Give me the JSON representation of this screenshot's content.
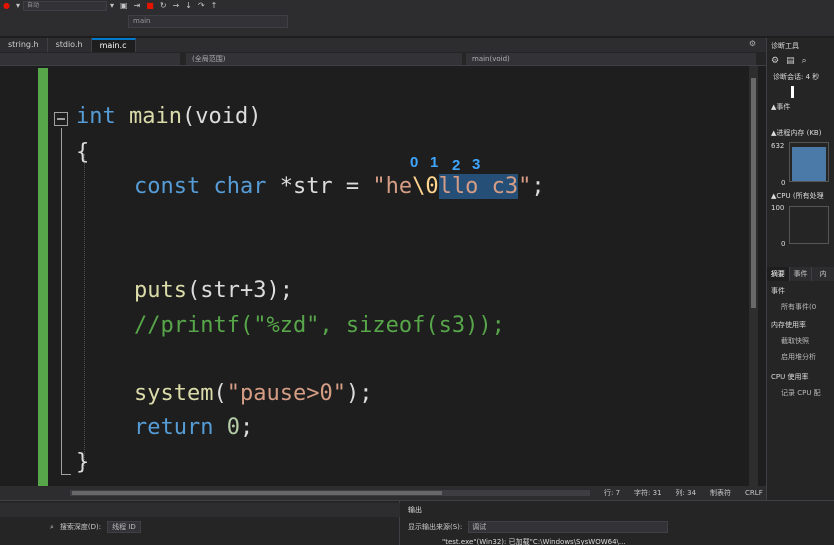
{
  "toolbar": {
    "config_value": "自动",
    "func_value": "main"
  },
  "tabs": [
    {
      "label": "string.h"
    },
    {
      "label": "stdio.h"
    },
    {
      "label": "main.c"
    }
  ],
  "navbar": {
    "scope": "(全局范围)",
    "function": "main(void)"
  },
  "code": {
    "line1_kw": "int",
    "line1_fn": "main",
    "line1_rest": "(void)",
    "line2": "{",
    "line3_kw": "const char",
    "line3_mid": " *str = ",
    "line3_q1": "\"he",
    "line3_esc": "\\0",
    "line3_sel": "llo c3",
    "line3_q2": "\"",
    "line3_end": ";",
    "line4_fn": "puts",
    "line4_rest": "(str+3);",
    "line5": "//printf(\"%zd\", sizeof(s3));",
    "line6_fn": "system",
    "line6_p1": "(",
    "line6_str": "\"pause>0\"",
    "line6_p2": ");",
    "line7_kw": "return",
    "line7_num": " 0",
    "line7_end": ";",
    "line8": "}"
  },
  "annotations": [
    "0",
    "1",
    "2",
    "3"
  ],
  "status": {
    "line": "行: 7",
    "char": "字符: 31",
    "col": "列: 34",
    "tab": "制表符",
    "eol": "CRLF"
  },
  "output": {
    "title": "输出",
    "source_label": "显示输出来源(S):",
    "source_value": "调试",
    "text": "\"test.exe\"(Win32): 已加载\"C:\\Windows\\SysWOW64\\..."
  },
  "bottom_left": {
    "search_label": "搜索深度(D):",
    "thread_value": "线程 ID"
  },
  "diagnostics": {
    "title": "诊断工具",
    "session": "诊断会话: 4 秒",
    "events": "▲事件",
    "memory": "▲进程内存 (KB)",
    "mem_max": "632",
    "mem_min": "0",
    "cpu": "▲CPU (所有处理",
    "cpu_max": "100",
    "cpu_min": "0",
    "tabs": [
      "摘要",
      "事件",
      "内"
    ],
    "sec_events": "事件",
    "item_all_events": "所有事件(0",
    "sec_memory": "内存使用率",
    "item_snapshot": "截取快照",
    "item_heap": "启用堆分析",
    "sec_cpu": "CPU 使用率",
    "item_cpu": "记录 CPU 配"
  },
  "colors": {
    "keyword": "#569cd6",
    "function": "#dcdcaa",
    "string": "#d69d85",
    "comment": "#57a64a",
    "accent": "#007acc",
    "annotation": "#3ea6ff"
  }
}
